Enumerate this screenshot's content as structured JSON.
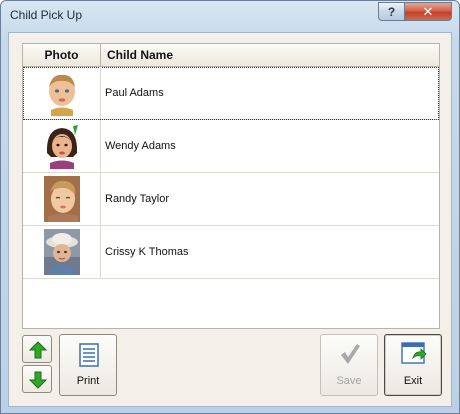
{
  "window": {
    "title": "Child Pick Up",
    "help_glyph": "?",
    "close_glyph": "✕"
  },
  "grid": {
    "columns": [
      "Photo",
      "Child Name"
    ],
    "rows": [
      {
        "name": "Paul Adams",
        "photo": "child-photo-boy"
      },
      {
        "name": "Wendy Adams",
        "photo": "child-photo-girl"
      },
      {
        "name": "Randy Taylor",
        "photo": "child-photo-toddler"
      },
      {
        "name": "Crissy K Thomas",
        "photo": "child-photo-child-with-hat"
      }
    ],
    "selected_row": 0
  },
  "buttons": {
    "move_up": {
      "icon": "green-arrow-up-icon"
    },
    "move_down": {
      "icon": "green-arrow-down-icon"
    },
    "print": {
      "label": "Print",
      "icon": "document-icon"
    },
    "save": {
      "label": "Save",
      "icon": "checkmark-icon",
      "enabled": false
    },
    "exit": {
      "label": "Exit",
      "icon": "exit-window-icon"
    }
  },
  "colors": {
    "arrow_green": "#2fa82a",
    "title_bar": "#c6d9ec",
    "client_bg": "#f2f0e8",
    "close_red": "#c2412a"
  }
}
